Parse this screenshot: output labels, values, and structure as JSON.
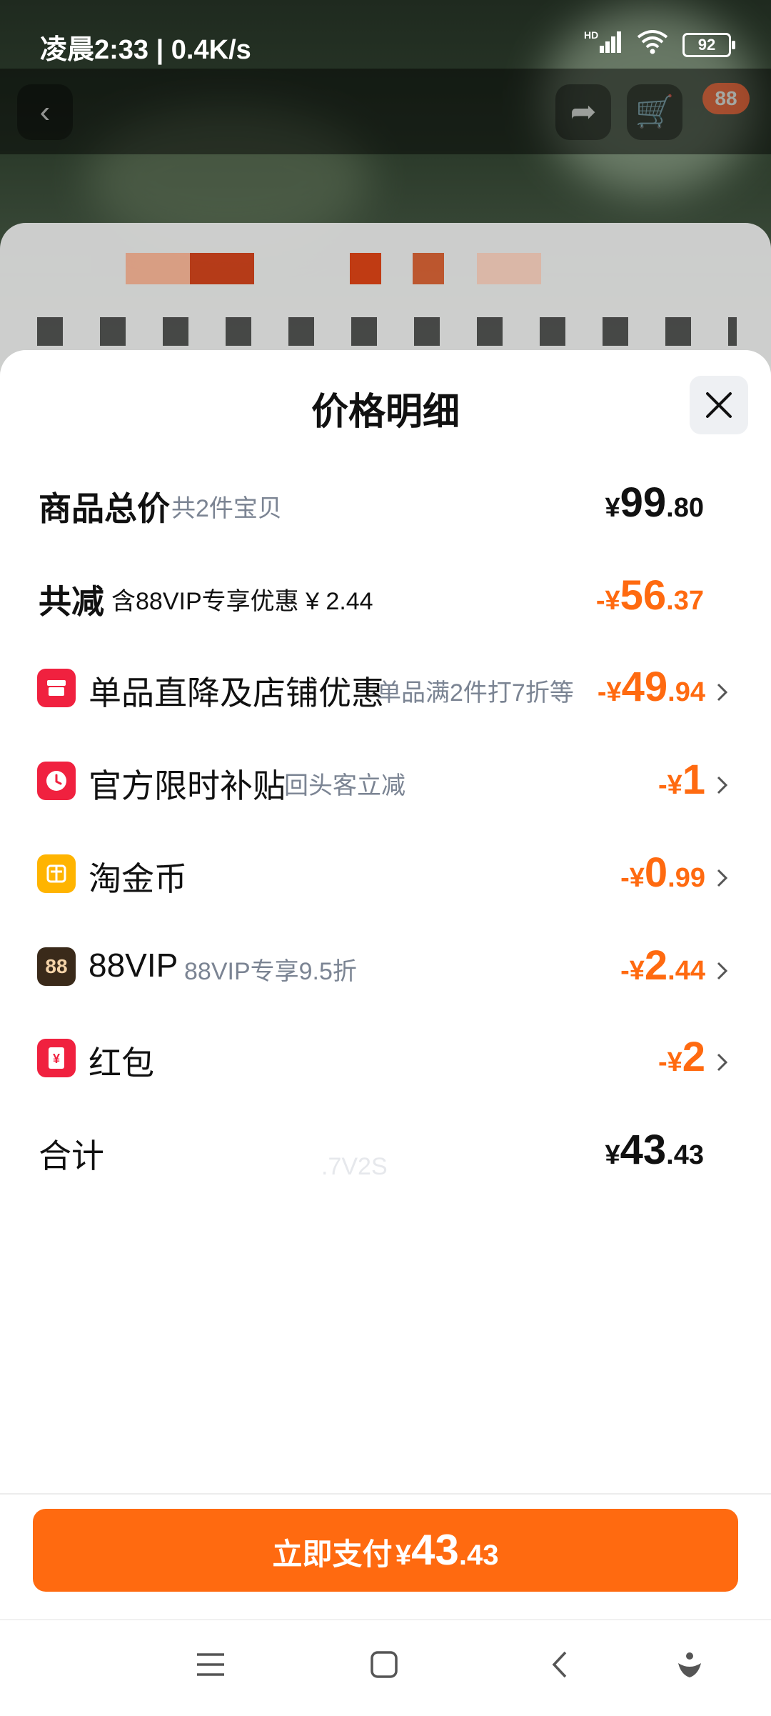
{
  "status_bar": {
    "time": "凌晨2:33 | 0.4K/s",
    "battery": "92",
    "network": "HD"
  },
  "top_nav": {
    "badge": "88"
  },
  "sheet": {
    "title": "价格明细",
    "rows": [
      {
        "label": "商品总价",
        "sub": "共2件宝贝",
        "amount": {
          "sym": "¥",
          "int": "99",
          "dec": ".80"
        }
      },
      {
        "label": "共减",
        "sub": "含88VIP专享优惠 ¥ 2.44",
        "amount": {
          "sym": "-¥",
          "int": "56",
          "dec": ".37"
        }
      },
      {
        "label": "单品直降及店铺优惠",
        "sub": "单品满2件打7折等",
        "amount": {
          "sym": "-¥",
          "int": "49",
          "dec": ".94"
        },
        "icon": "shop-icon"
      },
      {
        "label": "官方限时补贴",
        "sub": "回头客立减",
        "amount": {
          "sym": "-¥",
          "int": "1",
          "dec": ""
        },
        "icon": "clock-icon"
      },
      {
        "label": "淘金币",
        "sub": "",
        "amount": {
          "sym": "-¥",
          "int": "0",
          "dec": ".99"
        },
        "icon": "coin-icon"
      },
      {
        "label": "88VIP",
        "sub": "88VIP专享9.5折",
        "amount": {
          "sym": "-¥",
          "int": "2",
          "dec": ".44"
        },
        "icon": "vip-88-icon",
        "icon_text": "88"
      },
      {
        "label": "红包",
        "sub": "",
        "amount": {
          "sym": "-¥",
          "int": "2",
          "dec": ""
        },
        "icon": "red-packet-icon"
      },
      {
        "label": "合计",
        "sub": "",
        "amount": {
          "sym": "¥",
          "int": "43",
          "dec": ".43"
        }
      }
    ],
    "watermark": ".7V2S"
  },
  "pay": {
    "label": "立即支付",
    "sym": "¥",
    "int": "43",
    "dec": ".43"
  },
  "colors": {
    "accent": "#ff6a10",
    "icon_red": "#f0213f",
    "icon_yellow": "#ffb400",
    "icon_vip": "#3a2a1a"
  }
}
